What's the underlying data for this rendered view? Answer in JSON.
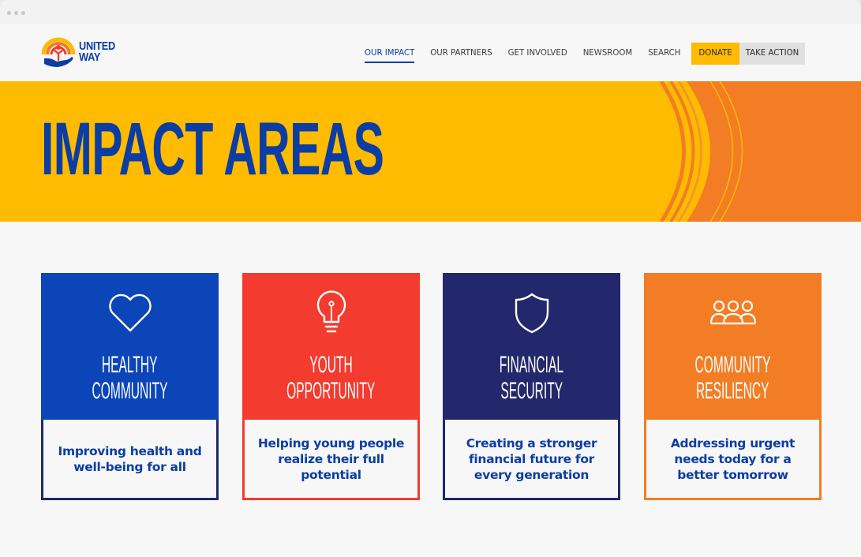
{
  "logo": {
    "line1": "UNITED",
    "line2": "WAY"
  },
  "nav": {
    "items": [
      "OUR IMPACT",
      "OUR PARTNERS",
      "GET INVOLVED",
      "NEWSROOM",
      "SEARCH"
    ],
    "donate": "DONATE",
    "take_action": "TAKE ACTION"
  },
  "hero": {
    "title": "IMPACT AREAS"
  },
  "cards": [
    {
      "title_line1": "HEALTHY",
      "title_line2": "COMMUNITY",
      "desc": "Improving health and well-being for all",
      "color": "#0b45b8",
      "border": "#1f2a6b",
      "icon": "heart-icon"
    },
    {
      "title_line1": "YOUTH",
      "title_line2": "OPPORTUNITY",
      "desc": "Helping young people realize their full potential",
      "color": "#f33b2f",
      "border": "#f33b2f",
      "icon": "lightbulb-icon"
    },
    {
      "title_line1": "FINANCIAL",
      "title_line2": "SECURITY",
      "desc": "Creating a stronger financial future for every generation",
      "color": "#22286b",
      "border": "#22286b",
      "icon": "shield-icon"
    },
    {
      "title_line1": "COMMUNITY",
      "title_line2": "RESILIENCY",
      "desc": "Addressing urgent needs today for a better tomorrow",
      "color": "#f27d24",
      "border": "#f27d24",
      "icon": "people-group-icon"
    }
  ],
  "colors": {
    "brand_blue": "#0b3da3",
    "brand_yellow": "#ffbb00",
    "brand_orange": "#f27d24"
  }
}
